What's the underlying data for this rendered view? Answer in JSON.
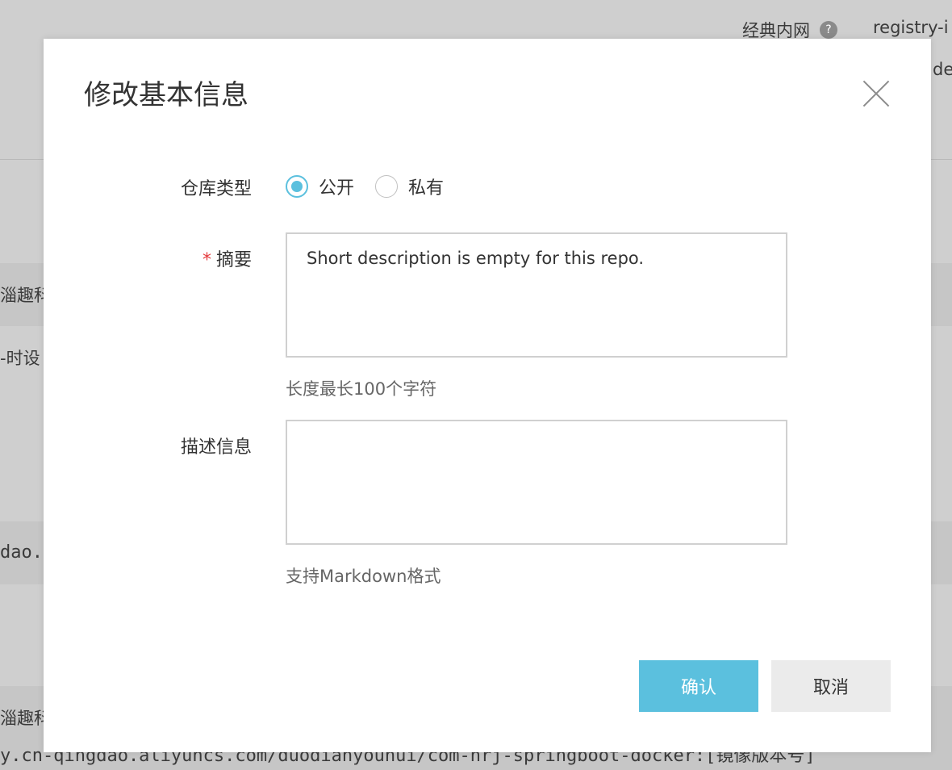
{
  "background": {
    "network_label": "经典内网",
    "help_glyph": "?",
    "registry_host": "registry-i",
    "partial_desc": "des",
    "row1_label": "趣科",
    "row1_prefix": "淄",
    "row2_text": "时设",
    "row2_prefix": "-",
    "row3_text": "dao.",
    "row4_label": "趣科",
    "row4_prefix": "淄",
    "row5_mono": "y.cn-qingdao.aliyuncs.com/duodianyouhui/com-hrj-springboot-docker:[镜像版本号]"
  },
  "modal": {
    "title": "修改基本信息",
    "repo_type": {
      "label": "仓库类型",
      "options": [
        {
          "label": "公开",
          "checked": true
        },
        {
          "label": "私有",
          "checked": false
        }
      ]
    },
    "summary": {
      "required_mark": "*",
      "label": "摘要",
      "value": "Short description is empty for this repo.",
      "hint": "长度最长100个字符"
    },
    "description": {
      "label": "描述信息",
      "value": "",
      "hint": "支持Markdown格式"
    },
    "buttons": {
      "confirm": "确认",
      "cancel": "取消"
    }
  },
  "colors": {
    "accent": "#5bc0de",
    "required": "#e4393c",
    "overlay": "#cfcfcf"
  }
}
